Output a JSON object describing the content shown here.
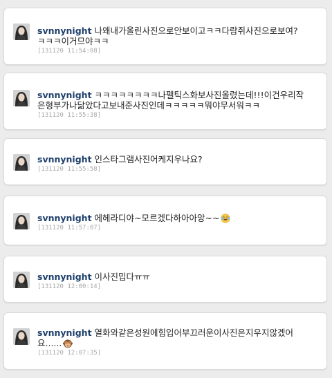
{
  "messages": [
    {
      "user": "svnnynight",
      "text_line1": "나왜내가올린사진으로안보이고ㅋㅋ다람쥐사진으로보여?",
      "text_line2": "ㅋㅋㅋ이거므야ㅋㅋ",
      "time": "[131120 11:54:08]"
    },
    {
      "user": "svnnynight",
      "text_line1": "ㅋㅋㅋㅋㅋㅋㅋㅋ나펠틱스화보사진올렸는데!!!이건우리작",
      "text_line2": "은형부가나닮았다고보내준사진인데ㅋㅋㅋㅋㅋ뭐야무서워ㅋㅋ",
      "time": "[131120 11:55:38]"
    },
    {
      "user": "svnnynight",
      "text_line1": "인스타그램사진어케지우나요?",
      "time": "[131120 11:55:58]"
    },
    {
      "user": "svnnynight",
      "text_line1": "에헤라디야~모르겠다하아아앙~~",
      "emoji": "tears-of-joy-emoji",
      "time": "[131120 11:57:07]"
    },
    {
      "user": "svnnynight",
      "text_line1": "이사진밉다ㅠㅠ",
      "time": "[131120 12:00:14]"
    },
    {
      "user": "svnnynight",
      "text_line1": "열화와같은성원에힘입어부끄러운이사진은지우지않겠어",
      "text_line2": "요......",
      "emoji": "see-no-evil-monkey-emoji",
      "time": "[131120 12:07:35]"
    }
  ],
  "colors": {
    "username": "#1e3f6b",
    "timestamp": "#a9a9a9",
    "card_bg": "#ffffff",
    "page_bg": "#ececec"
  }
}
